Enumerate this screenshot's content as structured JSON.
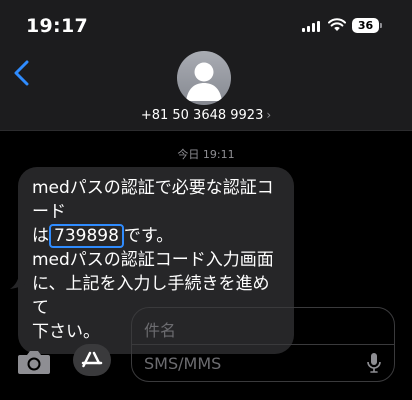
{
  "status_bar": {
    "time": "19:17",
    "battery": "36"
  },
  "header": {
    "contact_number": "+81 50 3648 9923",
    "chevron": "›"
  },
  "conversation": {
    "timestamp": "今日 19:11",
    "message": {
      "line1": "medパスの認証で必要な認証コード",
      "line2_prefix": "は",
      "code": "739898",
      "line2_suffix": "です。",
      "line3": "medパスの認証コード入力画面",
      "line4": "に、上記を入力し手続きを進めて",
      "line5": "下さい。"
    }
  },
  "composer": {
    "subject_placeholder": "件名",
    "message_placeholder": "SMS/MMS"
  },
  "colors": {
    "accent": "#2f8cff",
    "bubble": "#262628",
    "header_bg": "#1c1c1e",
    "secondary_text": "#8e8e93"
  },
  "icons": [
    "signal-icon",
    "wifi-icon",
    "battery-icon",
    "back-chevron-icon",
    "avatar-icon",
    "camera-icon",
    "app-store-icon",
    "microphone-icon"
  ]
}
